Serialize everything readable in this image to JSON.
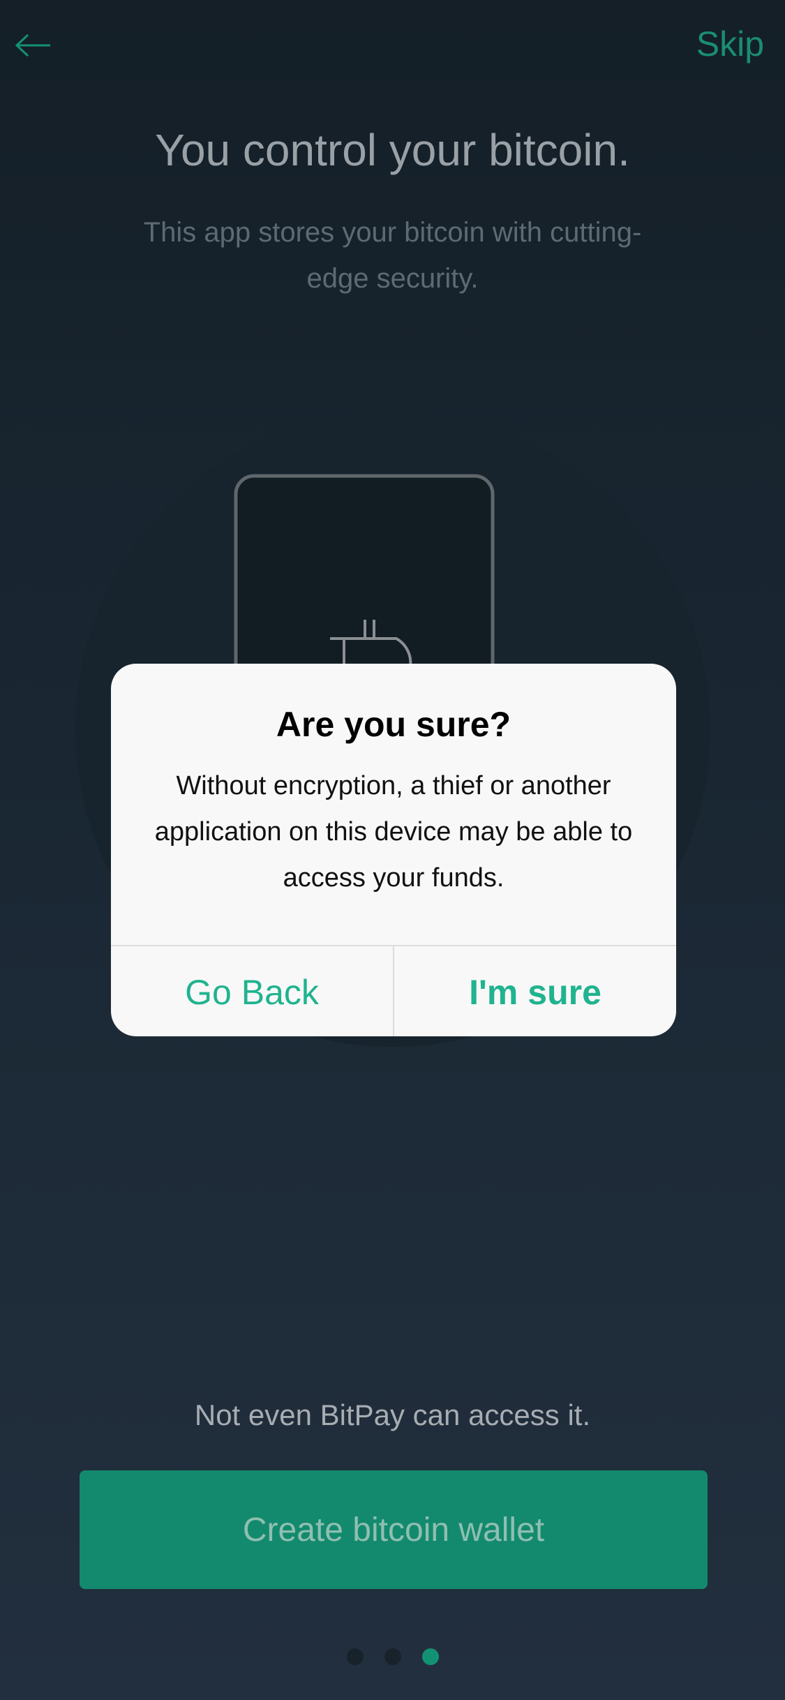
{
  "header": {
    "skip_label": "Skip"
  },
  "main": {
    "title": "You control your bitcoin.",
    "subtitle": "This app stores your bitcoin with cutting-edge security.",
    "footer_text": "Not even BitPay can access it.",
    "create_button_label": "Create bitcoin wallet"
  },
  "pagination": {
    "total": 3,
    "active_index": 2
  },
  "dialog": {
    "title": "Are you sure?",
    "message": "Without encryption, a thief or another application on this device may be able to access your funds.",
    "cancel_label": "Go Back",
    "confirm_label": "I'm sure"
  },
  "colors": {
    "accent": "#139273",
    "dialog_button": "#20b38f"
  },
  "icons": {
    "back": "arrow-left-icon",
    "illustration": "bitcoin-symbol-icon"
  }
}
